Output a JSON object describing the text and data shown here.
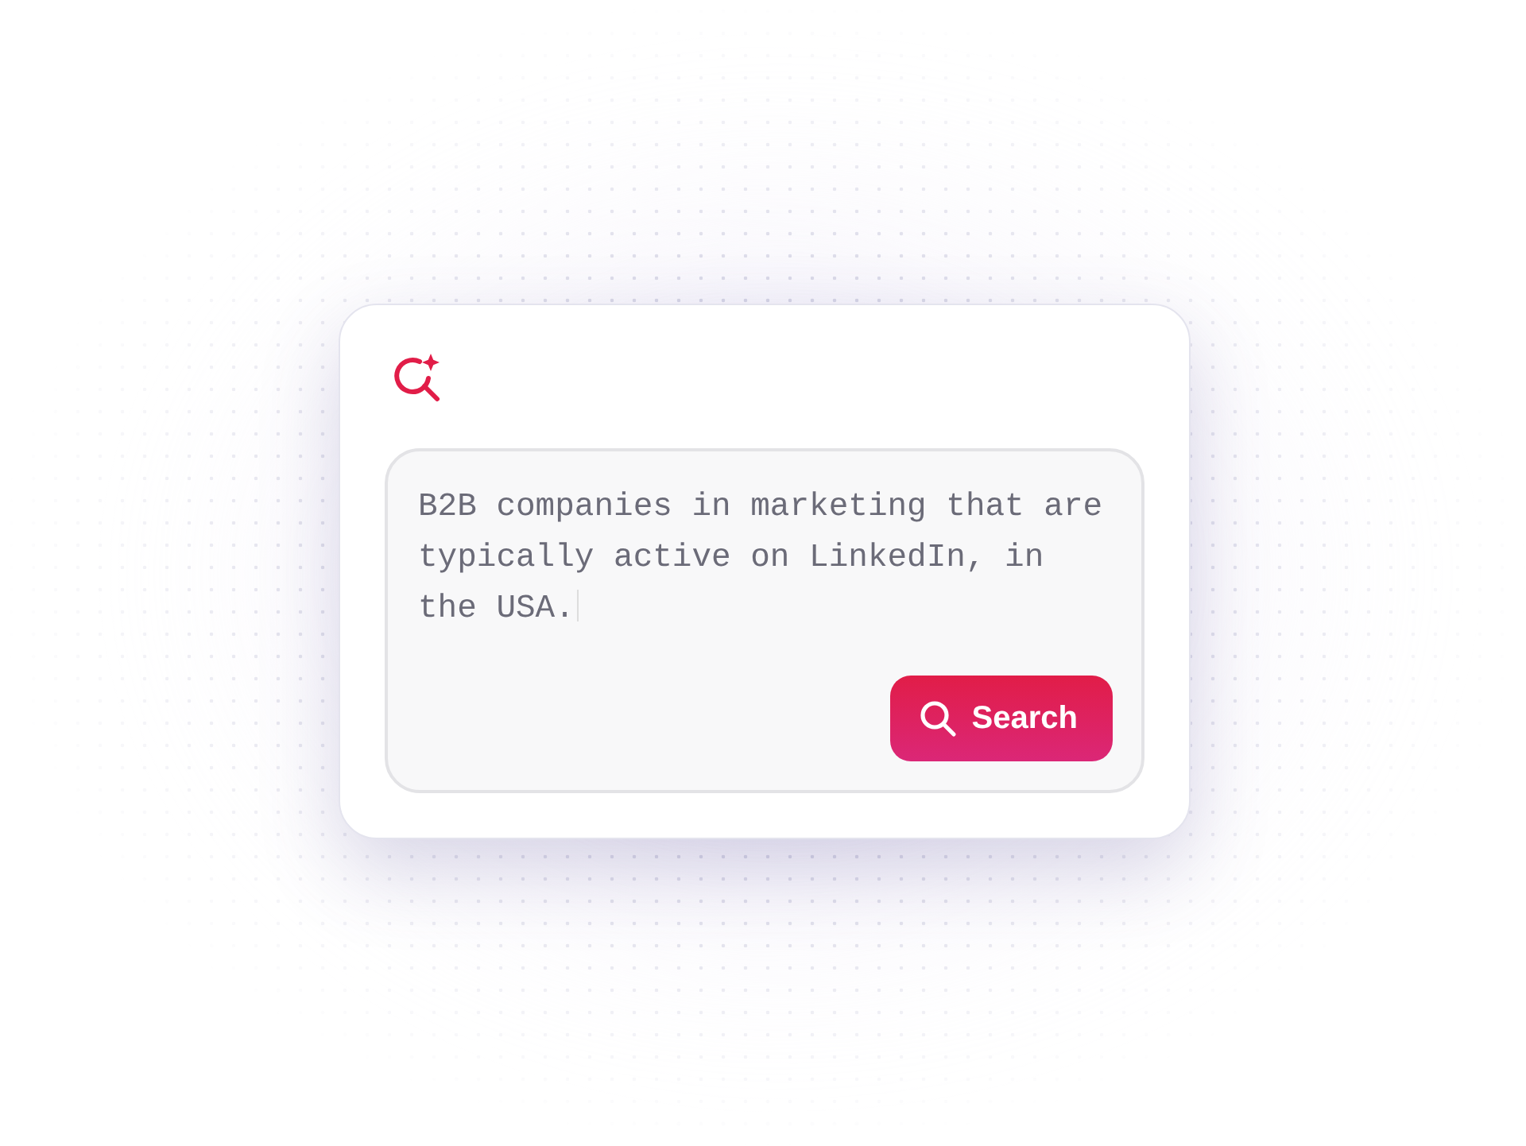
{
  "query": {
    "value": "B2B companies in marketing that are typically active on LinkedIn, in the USA."
  },
  "search_button": {
    "label": "Search"
  }
}
